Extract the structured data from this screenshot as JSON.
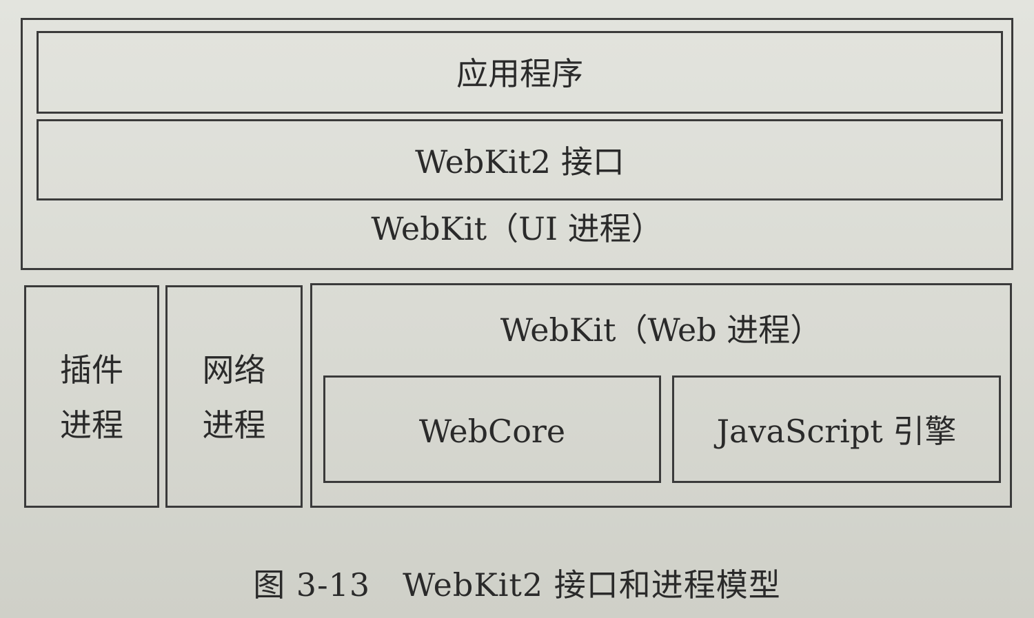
{
  "diagram": {
    "ui_process": {
      "label": "WebKit（UI 进程）",
      "application": "应用程序",
      "webkit2_interface": "WebKit2 接口"
    },
    "plugin_process": {
      "line1": "插件",
      "line2": "进程"
    },
    "network_process": {
      "line1": "网络",
      "line2": "进程"
    },
    "web_process": {
      "label": "WebKit（Web 进程）",
      "webcore": "WebCore",
      "js_engine": "JavaScript 引擎"
    }
  },
  "caption": "图 3-13　WebKit2 接口和进程模型"
}
